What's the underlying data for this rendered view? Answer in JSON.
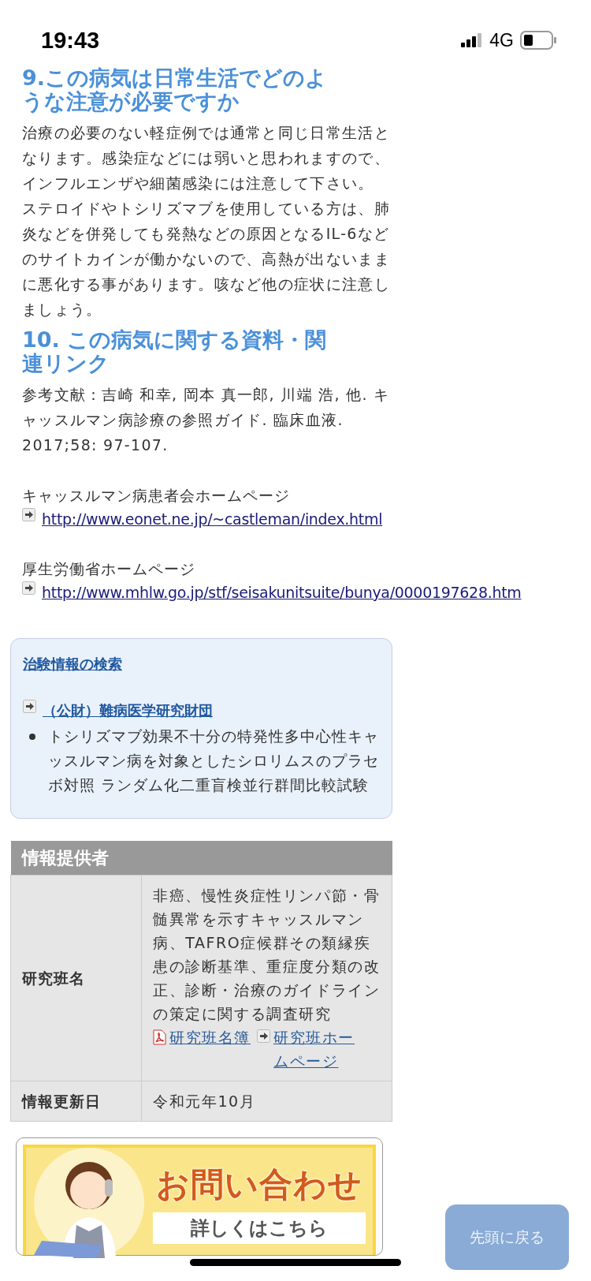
{
  "status_bar": {
    "time": "19:43",
    "network": "4G"
  },
  "sections": [
    {
      "heading": "9.この病気は日常生活でどのような注意が必要ですか",
      "paragraphs": [
        "治療の必要のない軽症例では通常と同じ日常生活となります。感染症などには弱いと思われますので、インフルエンザや細菌感染には注意して下さい。",
        "ステロイドやトシリズマブを使用している方は、肺炎などを併発しても発熱などの原因となるIL-6などのサイトカインが働かないので、高熱が出ないままに悪化する事があります。咳など他の症状に注意しましょう。"
      ]
    },
    {
      "heading": "10. この病気に関する資料・関連リンク",
      "paragraphs": [
        "参考文献：吉崎 和幸, 岡本 真一郎, 川端 浩, 他. キャッスルマン病診療の参照ガイド. 臨床血液. 2017;58: 97-107."
      ],
      "links": [
        {
          "label": "キャッスルマン病患者会ホームページ",
          "url": "http://www.eonet.ne.jp/~castleman/index.html"
        },
        {
          "label": "厚生労働省ホームページ",
          "url": "http://www.mhlw.go.jp/stf/seisakunitsuite/bunya/0000197628.htm"
        }
      ]
    }
  ],
  "trial_box": {
    "title": "治験情報の検索",
    "organization": "（公財）難病医学研究財団",
    "items": [
      "トシリズマブ効果不十分の特発性多中心性キャッスルマン病を対象としたシロリムスのプラセボ対照 ランダム化二重盲検並行群間比較試験"
    ]
  },
  "provider_table": {
    "header": "情報提供者",
    "rows": [
      {
        "label": "研究班名",
        "value": "非癌、慢性炎症性リンパ節・骨髄異常を示すキャッスルマン病、TAFRO症候群その類縁疾患の診断基準、重症度分類の改正、診断・治療のガイドラインの策定に関する調査研究",
        "links": [
          {
            "kind": "pdf",
            "text": "研究班名簿"
          },
          {
            "kind": "external",
            "text": "研究班ホームページ"
          }
        ]
      },
      {
        "label": "情報更新日",
        "value": "令和元年10月",
        "links": []
      }
    ]
  },
  "contact_banner": {
    "title": "お問い合わせ",
    "button": "詳しくはこちら"
  },
  "back_to_top": "先頭に戻る"
}
